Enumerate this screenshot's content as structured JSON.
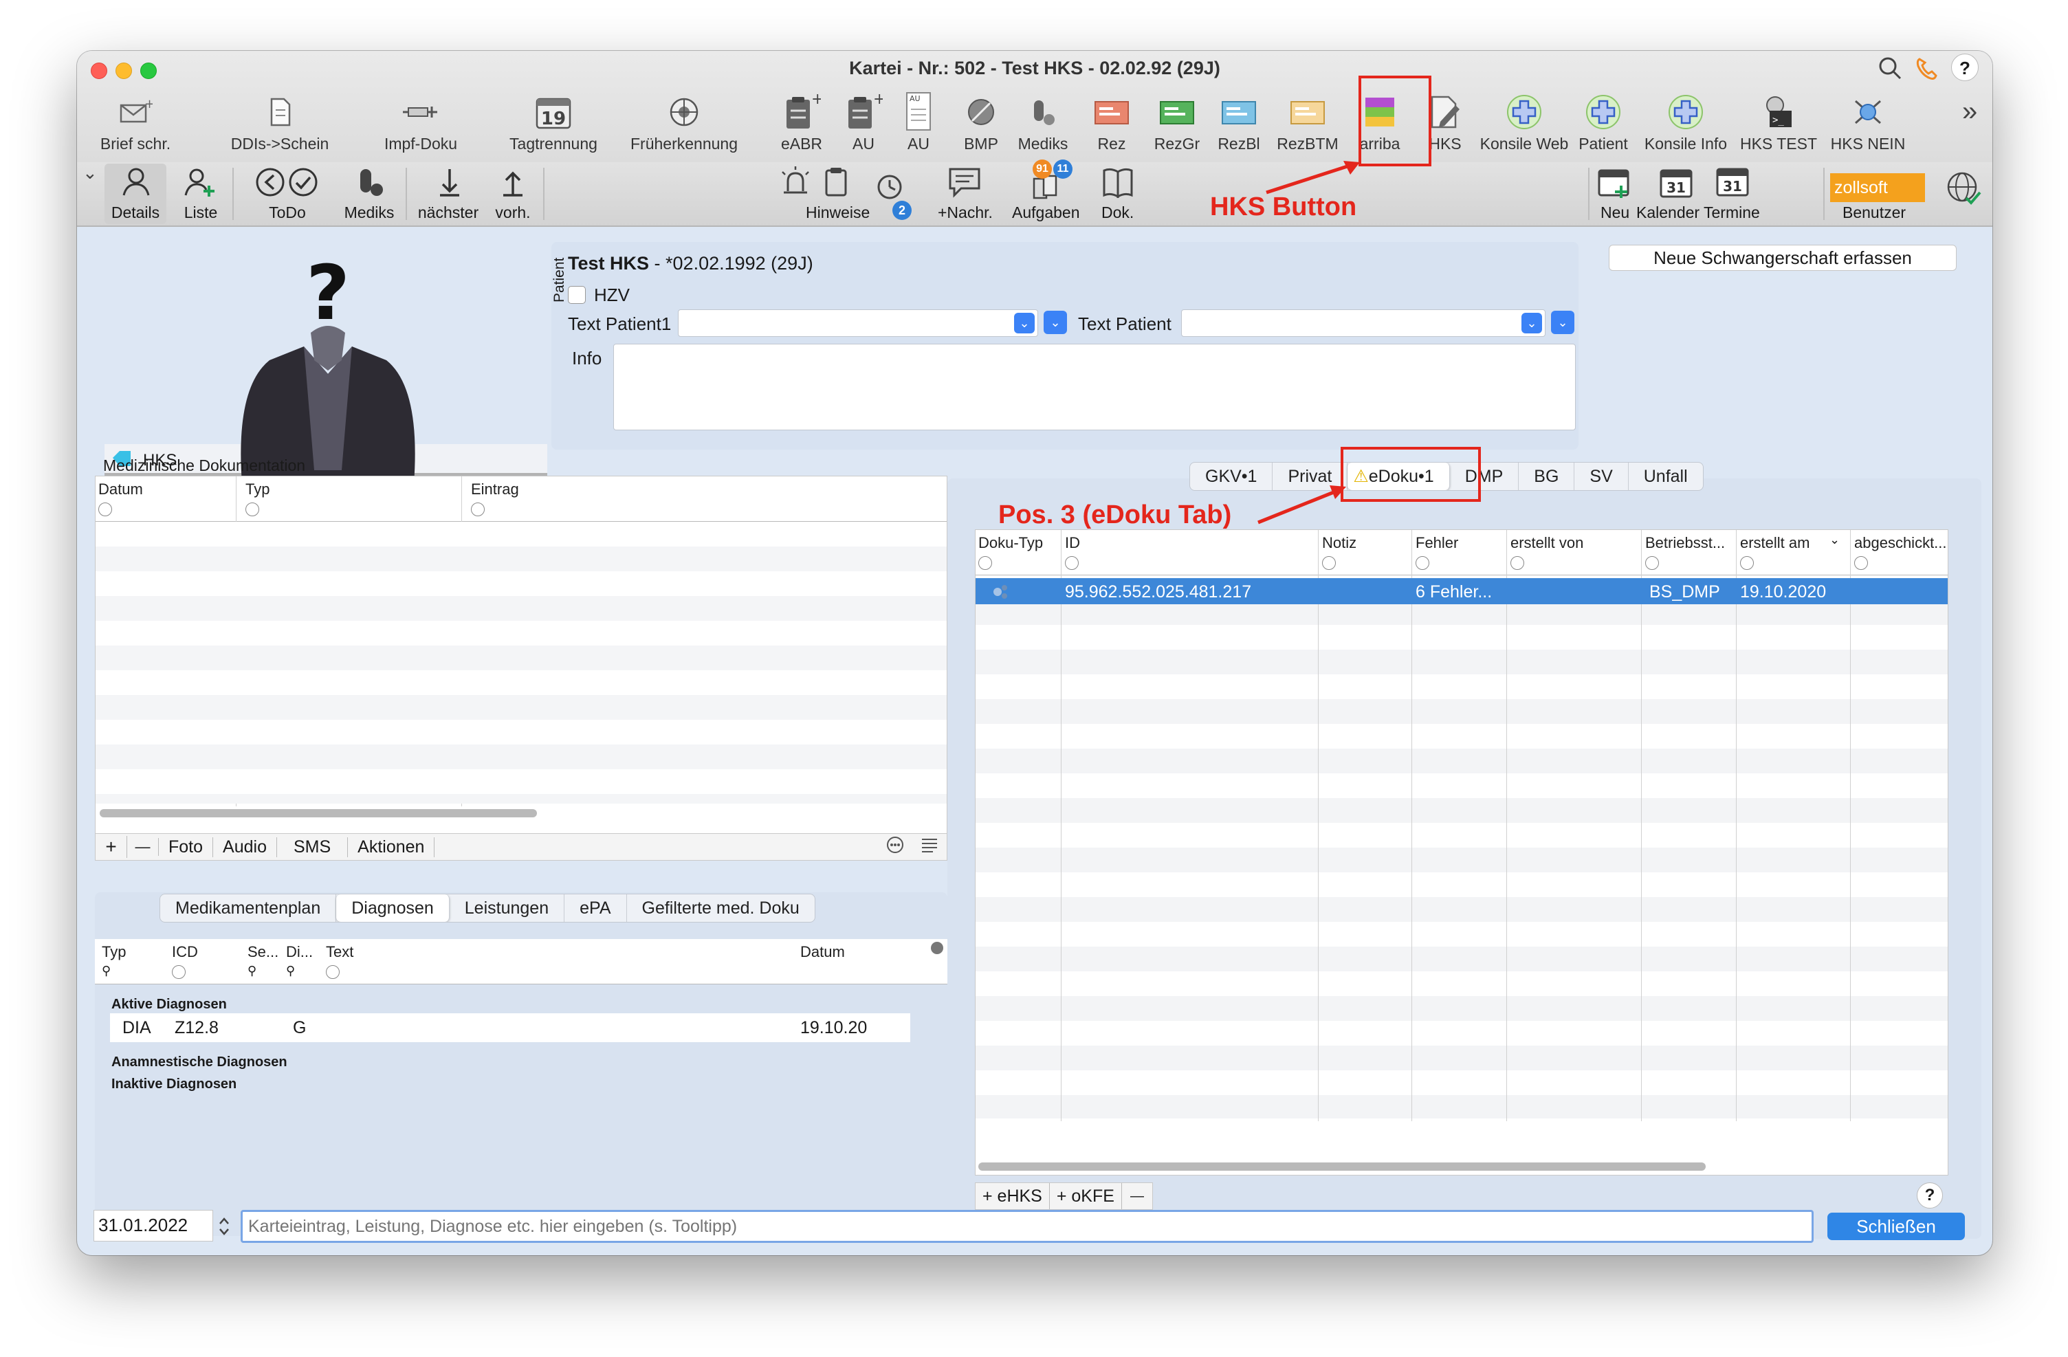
{
  "window": {
    "title": "Kartei - Nr.: 502 - Test HKS - 02.02.92 (29J)"
  },
  "toolbar": [
    {
      "label": "Brief schr.",
      "icon": "letter-icon"
    },
    {
      "label": "DDIs->Schein",
      "icon": "document-icon"
    },
    {
      "label": "Impf-Doku",
      "icon": "syringe-icon"
    },
    {
      "label": "Tagtrennung",
      "icon": "calendar-19-icon",
      "badge": "19"
    },
    {
      "label": "Früherkennung",
      "icon": "screening-icon"
    },
    {
      "label": "eABR",
      "icon": "clipboard-plus-icon"
    },
    {
      "label": "AU",
      "icon": "clipboard-plus-icon"
    },
    {
      "label": "AU",
      "icon": "au-form-icon"
    },
    {
      "label": "BMP",
      "icon": "pill-icon"
    },
    {
      "label": "Mediks",
      "icon": "capsule-icon"
    },
    {
      "label": "Rez",
      "icon": "prescription-red-icon"
    },
    {
      "label": "RezGr",
      "icon": "prescription-green-icon"
    },
    {
      "label": "RezBl",
      "icon": "prescription-blue-icon"
    },
    {
      "label": "RezBTM",
      "icon": "prescription-yellow-icon"
    },
    {
      "label": "arriba",
      "icon": "arriba-icon"
    },
    {
      "label": "HKS",
      "icon": "hks-edit-icon"
    },
    {
      "label": "Konsile Web",
      "icon": "konsile-icon"
    },
    {
      "label": "Patient",
      "icon": "konsile-icon"
    },
    {
      "label": "Konsile Info",
      "icon": "konsile-icon"
    },
    {
      "label": "HKS TEST",
      "icon": "terminal-icon"
    },
    {
      "label": "HKS NEIN",
      "icon": "network-icon"
    }
  ],
  "toolbar2": {
    "details": "Details",
    "liste": "Liste",
    "todo": "ToDo",
    "mediks": "Mediks",
    "naechster": "nächster",
    "vorh": "vorh.",
    "hinweise": "Hinweise",
    "hinweise_badge": "2",
    "nachr": "+Nachr.",
    "aufgaben": "Aufgaben",
    "aufgaben_badge1": "91",
    "aufgaben_badge2": "11",
    "dok": "Dok.",
    "neu": "Neu",
    "kalender": "Kalender",
    "kalender_day": "31",
    "termine": "Termine",
    "zollsoft": "zollsoft",
    "benutzer": "Benutzer"
  },
  "patient": {
    "tag": "HKS",
    "side_label": "Patient",
    "name": "Test HKS",
    "birth": " - *02.02.1992 (29J)",
    "hzv": "HZV",
    "text_patient1": "Text Patient1",
    "text_patient2": "Text Patient",
    "info": "Info",
    "schwangerschaft_button": "Neue Schwangerschaft erfassen"
  },
  "med_doku": {
    "title": "Medizinische Dokumentation",
    "columns": [
      "Datum",
      "Typ",
      "Eintrag"
    ],
    "buttons": [
      "+",
      "—",
      "Foto",
      "Audio",
      "SMS",
      "Aktionen"
    ]
  },
  "bottom_tabs": {
    "items": [
      "Medikamentenplan",
      "Diagnosen",
      "Leistungen",
      "ePA",
      "Gefilterte med. Doku"
    ],
    "selected": "Diagnosen"
  },
  "diagnosen": {
    "columns": [
      "Typ",
      "ICD",
      "Se...",
      "Di...",
      "Text",
      "Datum"
    ],
    "group_active": "Aktive Diagnosen",
    "rows": [
      {
        "typ": "DIA",
        "icd": "Z12.8",
        "di": "G",
        "datum": "19.10.20"
      }
    ],
    "group_anamnestisch": "Anamnestische Diagnosen",
    "group_inaktiv": "Inaktive Diagnosen"
  },
  "right_tabs": {
    "items": [
      "GKV•1",
      "Privat",
      "eDoku•1",
      "DMP",
      "BG",
      "SV",
      "Unfall"
    ],
    "selected": "eDoku•1"
  },
  "edoku": {
    "columns": [
      "Doku-Typ",
      "ID",
      "Notiz",
      "Fehler",
      "erstellt von",
      "Betriebsst...",
      "erstellt am",
      "abgeschickt..."
    ],
    "rows": [
      {
        "id": "95.962.552.025.481.217",
        "notiz": "",
        "fehler": "6 Fehler...",
        "erstellt_von": "",
        "betriebsstaette": "BS_DMP",
        "erstellt_am": "19.10.2020",
        "abgeschickt": ""
      }
    ],
    "add_ehks": "+ eHKS",
    "add_okfe": "+ oKFE",
    "remove": "—",
    "help": "?"
  },
  "footer": {
    "date": "31.01.2022",
    "placeholder": "Karteieintrag, Leistung, Diagnose etc. hier eingeben (s. Tooltipp)",
    "close": "Schließen"
  },
  "annotations": {
    "hks_button": "HKS Button",
    "edoku_tab": "Pos. 3 (eDoku Tab)"
  },
  "colors": {
    "accent": "#3b82f6",
    "selection": "#3d87d8",
    "annotation_red": "#e4261c",
    "zollsoft_orange": "#f4a11d"
  }
}
